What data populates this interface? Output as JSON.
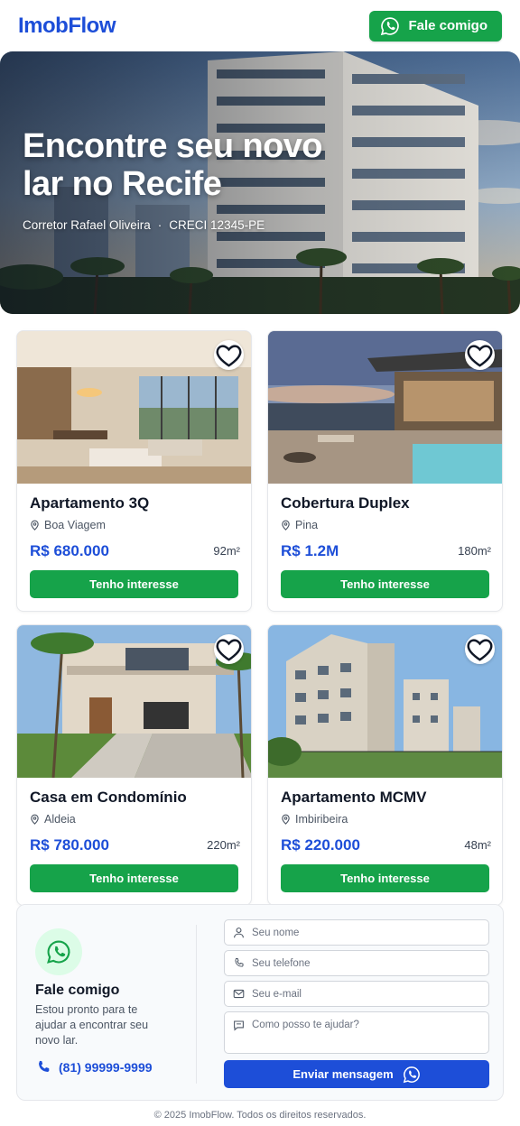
{
  "header": {
    "logo": "ImobFlow",
    "cta_label": "Fale comigo",
    "cta_icon": "whatsapp-icon"
  },
  "hero": {
    "title": "Encontre seu novo lar no Recife",
    "agent": "Corretor Rafael Oliveira",
    "separator": "·",
    "creci": "CRECI 12345-PE"
  },
  "listings": [
    {
      "title": "Apartamento 3Q",
      "location": "Boa Viagem",
      "price": "R$ 680.000",
      "area": "92m²",
      "button": "Tenho interesse"
    },
    {
      "title": "Cobertura Duplex",
      "location": "Pina",
      "price": "R$ 1.2M",
      "area": "180m²",
      "button": "Tenho interesse"
    },
    {
      "title": "Casa em Condomínio",
      "location": "Aldeia",
      "price": "R$ 780.000",
      "area": "220m²",
      "button": "Tenho interesse"
    },
    {
      "title": "Apartamento MCMV",
      "location": "Imbiribeira",
      "price": "R$ 220.000",
      "area": "48m²",
      "button": "Tenho interesse"
    }
  ],
  "contact": {
    "title": "Fale comigo",
    "text": "Estou pronto para te ajudar a encontrar seu novo lar.",
    "phone": "(81) 99999-9999",
    "fields": {
      "name": {
        "placeholder": "Seu nome",
        "value": ""
      },
      "phone": {
        "placeholder": "Seu telefone",
        "value": ""
      },
      "email": {
        "placeholder": "Seu e-mail",
        "value": ""
      },
      "message": {
        "placeholder": "Como posso te ajudar?",
        "value": ""
      }
    },
    "send_label": "Enviar mensagem"
  },
  "footer": {
    "text": "© 2025 ImobFlow. Todos os direitos reservados."
  },
  "colors": {
    "brand": "#1d4ed8",
    "whatsapp_green": "#16a34a"
  }
}
